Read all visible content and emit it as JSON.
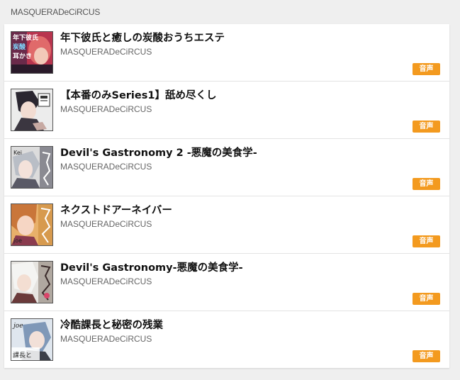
{
  "header": {
    "circle_name": "MASQUERADeCiRCUS"
  },
  "works": [
    {
      "title": "年下彼氏と癒しの炭酸おうちエステ",
      "circle": "MASQUERADeCiRCUS",
      "badge": "音声",
      "thumb_text_1": "年下彼氏",
      "thumb_text_2": "炭酸",
      "thumb_text_3": "耳かき"
    },
    {
      "title": "【本番のみSeries1】舐め尽くし",
      "circle": "MASQUERADeCiRCUS",
      "badge": "音声"
    },
    {
      "title": "Devil's Gastronomy 2 -悪魔の美食学-",
      "circle": "MASQUERADeCiRCUS",
      "badge": "音声",
      "thumb_text_1": "Kei"
    },
    {
      "title": "ネクストドアーネイバー",
      "circle": "MASQUERADeCiRCUS",
      "badge": "音声",
      "thumb_text_1": "joe"
    },
    {
      "title": "Devil's Gastronomy-悪魔の美食学-",
      "circle": "MASQUERADeCiRCUS",
      "badge": "音声"
    },
    {
      "title": "冷酷課長と秘密の残業",
      "circle": "MASQUERADeCiRCUS",
      "badge": "音声",
      "thumb_text_1": "joe",
      "thumb_text_2": "課長と"
    }
  ]
}
